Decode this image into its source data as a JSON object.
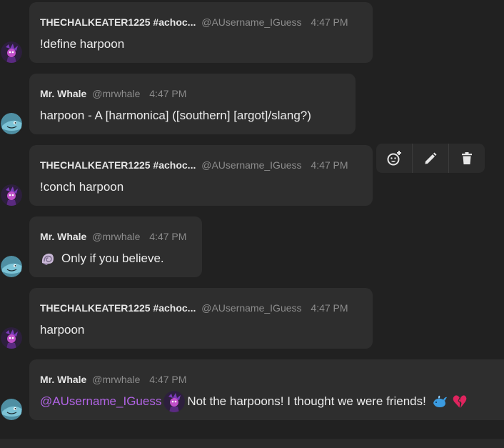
{
  "messages": [
    {
      "name": "THECHALKEATER1225 #achoc...",
      "handle": "@AUsername_IGuess",
      "time": "4:47 PM",
      "text": "!define harpoon",
      "avatar": "purple-character-avatar"
    },
    {
      "name": "Mr. Whale",
      "handle": "@mrwhale",
      "time": "4:47 PM",
      "text": "harpoon - A [harmonica] ([southern] [argot]/slang?)",
      "avatar": "whale-avatar"
    },
    {
      "name": "THECHALKEATER1225 #achoc...",
      "handle": "@AUsername_IGuess",
      "time": "4:47 PM",
      "text": "!conch harpoon",
      "avatar": "purple-character-avatar"
    },
    {
      "name": "Mr. Whale",
      "handle": "@mrwhale",
      "time": "4:47 PM",
      "text": "Only if you believe.",
      "emoji": "spiral-shell-icon",
      "avatar": "whale-avatar"
    },
    {
      "name": "THECHALKEATER1225 #achoc...",
      "handle": "@AUsername_IGuess",
      "time": "4:47 PM",
      "text": "harpoon",
      "avatar": "purple-character-avatar"
    },
    {
      "name": "Mr. Whale",
      "handle": "@mrwhale",
      "time": "4:47 PM",
      "mention": "@AUsername_IGuess",
      "text": "Not the harpoons! I thought we were friends!",
      "emojis": [
        "whale-icon",
        "broken-heart-icon"
      ],
      "avatar": "whale-avatar"
    }
  ],
  "toolbar": {
    "actions": [
      "add-reaction-icon",
      "edit-pencil-icon",
      "delete-trash-icon"
    ]
  },
  "colors": {
    "background": "#212121",
    "bubble": "#2e2e2e",
    "mention": "#b264e6",
    "timestamp": "#8c8c8c"
  }
}
